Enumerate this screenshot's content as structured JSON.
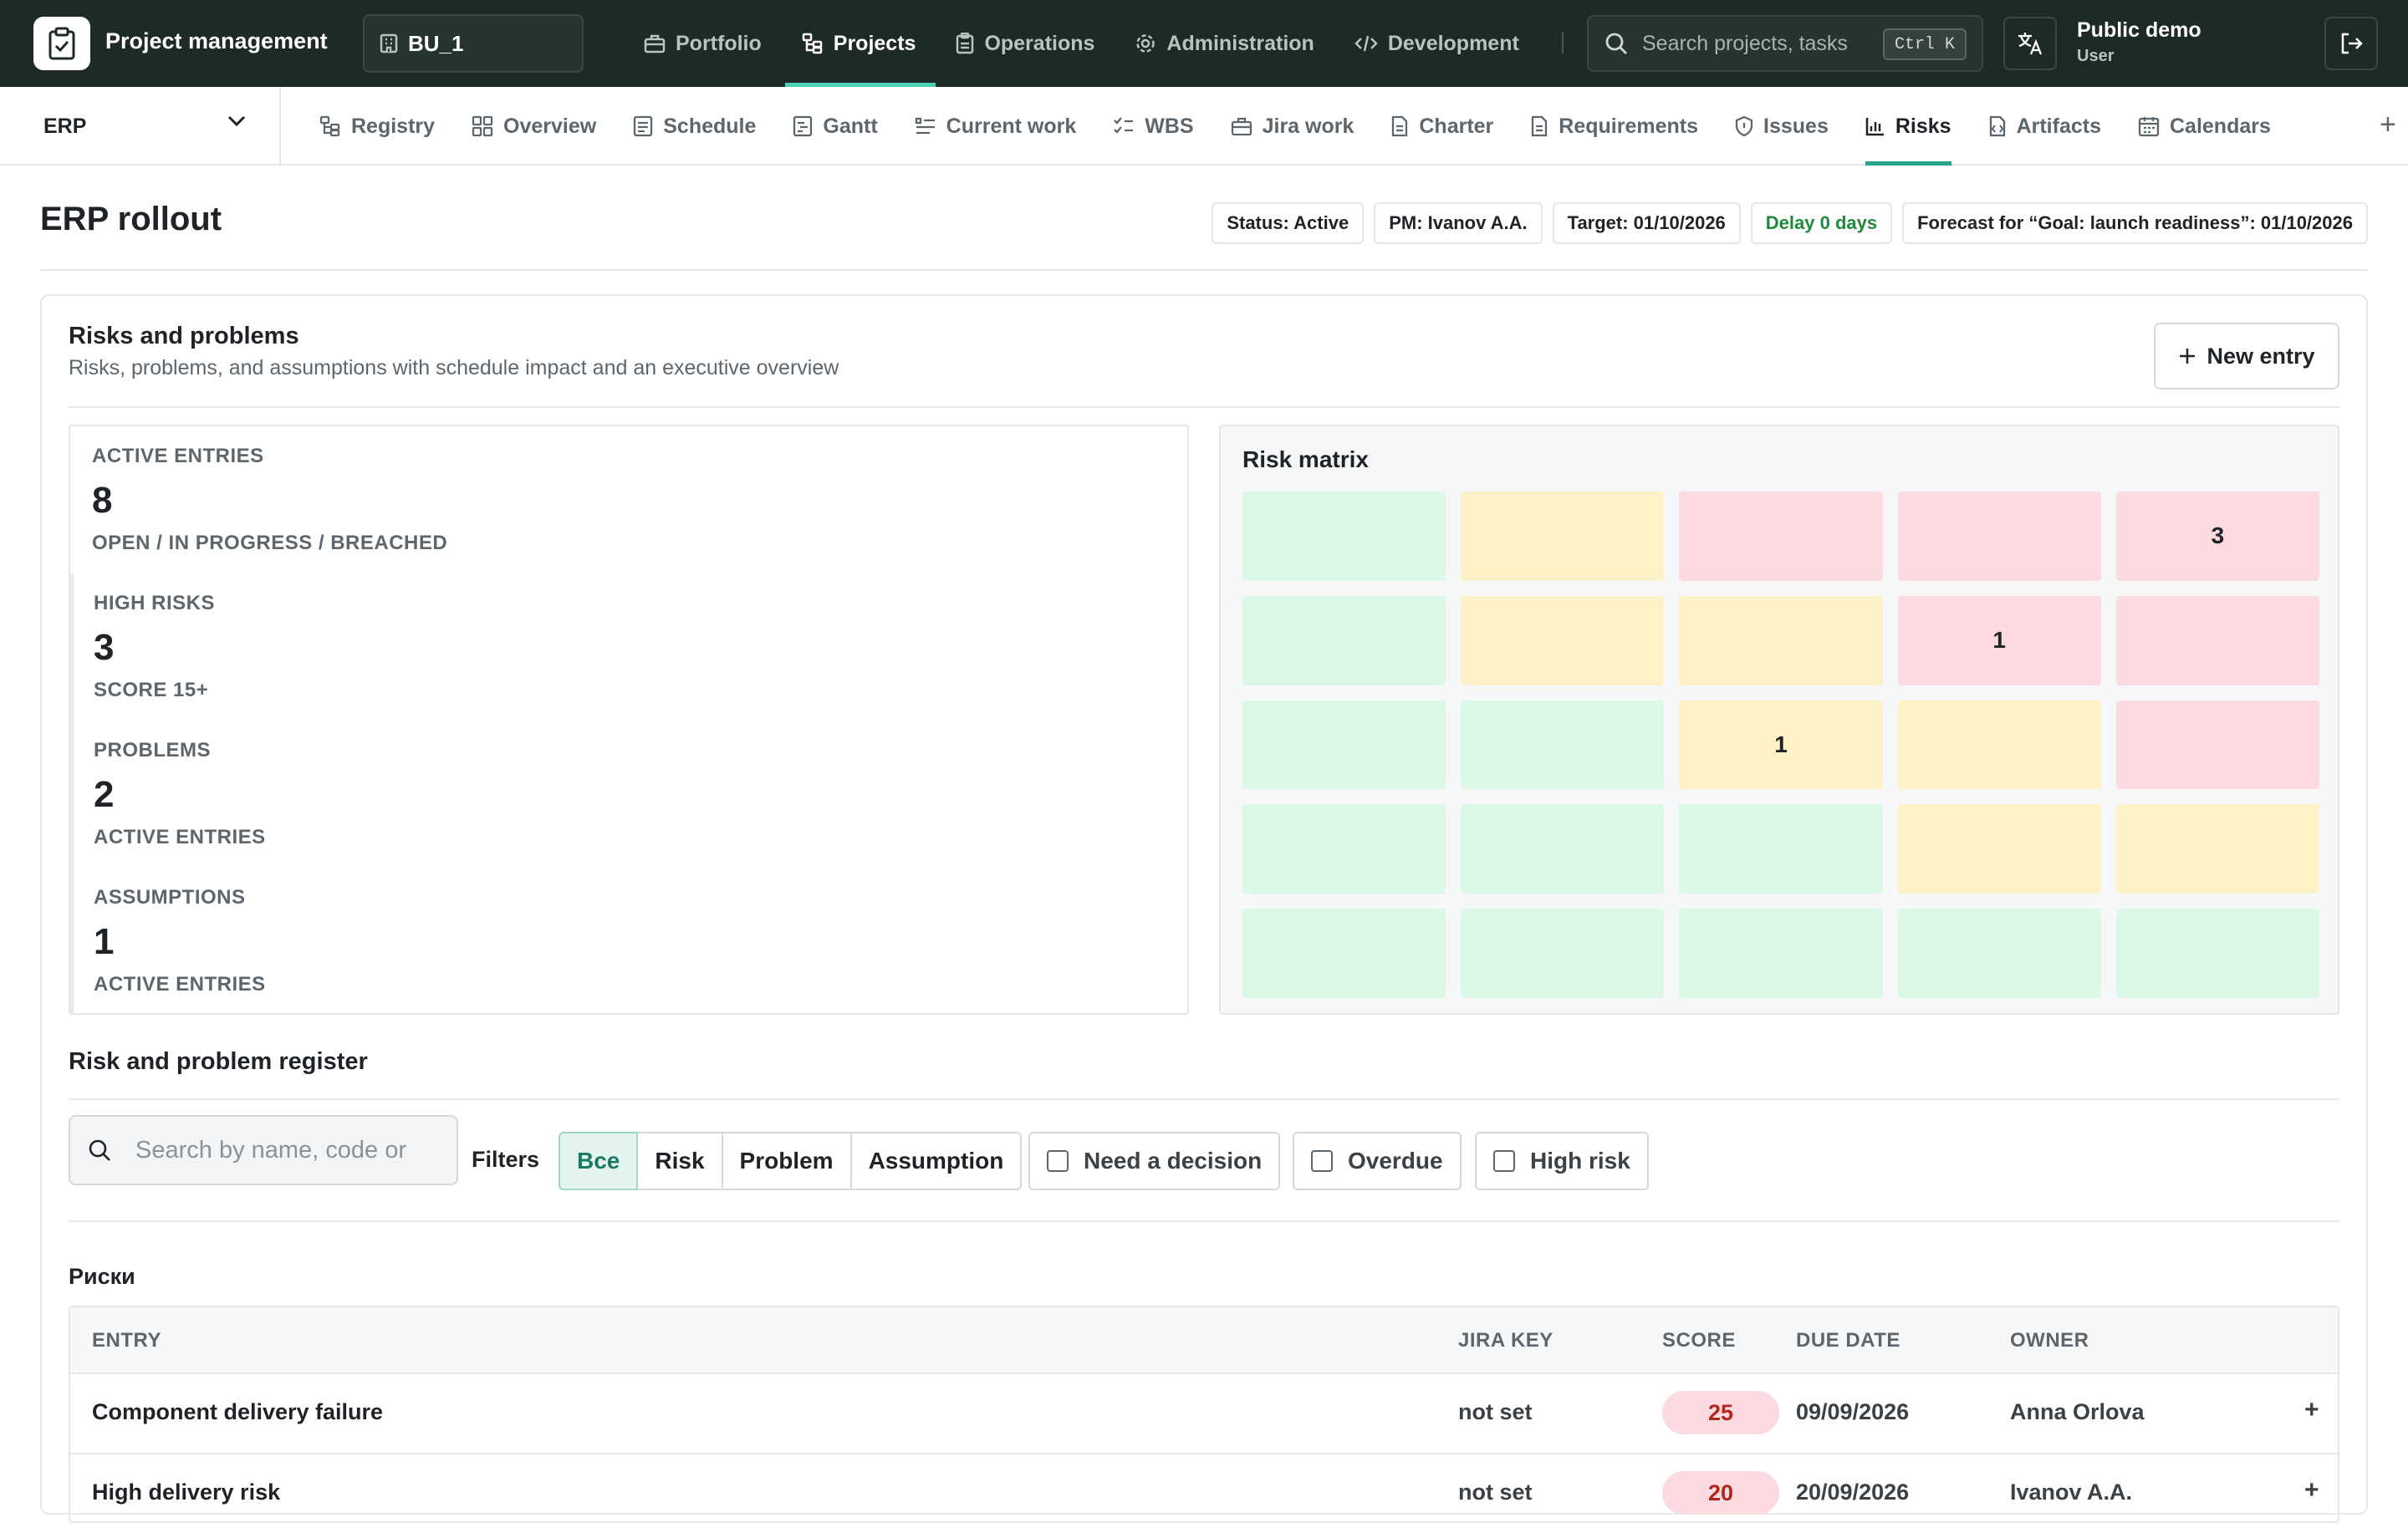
{
  "app": {
    "title": "Project management",
    "business_unit": "BU_1"
  },
  "top_nav": [
    {
      "label": "Portfolio",
      "icon": "briefcase-icon",
      "active": false
    },
    {
      "label": "Projects",
      "icon": "projects-icon",
      "active": true
    },
    {
      "label": "Operations",
      "icon": "clipboard-icon",
      "active": false
    },
    {
      "label": "Administration",
      "icon": "gear-icon",
      "active": false
    },
    {
      "label": "Development",
      "icon": "code-icon",
      "active": false
    }
  ],
  "search": {
    "placeholder": "Search projects, tasks",
    "shortcut": "Ctrl K"
  },
  "user": {
    "name": "Public demo",
    "role": "User"
  },
  "project_selector": {
    "value": "ERP"
  },
  "sub_nav": [
    {
      "label": "Registry",
      "icon": "registry-icon",
      "active": false
    },
    {
      "label": "Overview",
      "icon": "grid-icon",
      "active": false
    },
    {
      "label": "Schedule",
      "icon": "schedule-icon",
      "active": false
    },
    {
      "label": "Gantt",
      "icon": "gantt-icon",
      "active": false
    },
    {
      "label": "Current work",
      "icon": "list-icon",
      "active": false
    },
    {
      "label": "WBS",
      "icon": "checklist-icon",
      "active": false
    },
    {
      "label": "Jira work",
      "icon": "briefcase-icon",
      "active": false
    },
    {
      "label": "Charter",
      "icon": "document-icon",
      "active": false
    },
    {
      "label": "Requirements",
      "icon": "document-icon",
      "active": false
    },
    {
      "label": "Issues",
      "icon": "shield-icon",
      "active": false
    },
    {
      "label": "Risks",
      "icon": "bar-chart-icon",
      "active": true
    },
    {
      "label": "Artifacts",
      "icon": "file-icon",
      "active": false
    },
    {
      "label": "Calendars",
      "icon": "calendar-icon",
      "active": false
    }
  ],
  "page": {
    "title": "ERP rollout",
    "chips": {
      "status": "Status: Active",
      "pm": "PM: Ivanov A.A.",
      "target": "Target: 01/10/2026",
      "delay": "Delay 0 days",
      "forecast": "Forecast for “Goal: launch readiness”: 01/10/2026"
    }
  },
  "risks_card": {
    "title": "Risks and problems",
    "subtitle": "Risks, problems, and assumptions with schedule impact and an executive overview",
    "new_entry_label": "New entry"
  },
  "stats": [
    {
      "label": "ACTIVE ENTRIES",
      "value": "8",
      "note": "OPEN / IN PROGRESS / BREACHED"
    },
    {
      "label": "HIGH RISKS",
      "value": "3",
      "note": "SCORE 15+"
    },
    {
      "label": "PROBLEMS",
      "value": "2",
      "note": "ACTIVE ENTRIES"
    },
    {
      "label": "ASSUMPTIONS",
      "value": "1",
      "note": "ACTIVE ENTRIES"
    }
  ],
  "risk_matrix": {
    "title": "Risk matrix",
    "rows": [
      [
        {
          "level": "low",
          "count": ""
        },
        {
          "level": "medium",
          "count": ""
        },
        {
          "level": "high",
          "count": ""
        },
        {
          "level": "high",
          "count": ""
        },
        {
          "level": "high",
          "count": "3"
        }
      ],
      [
        {
          "level": "low",
          "count": ""
        },
        {
          "level": "medium",
          "count": ""
        },
        {
          "level": "medium",
          "count": ""
        },
        {
          "level": "high",
          "count": "1"
        },
        {
          "level": "high",
          "count": ""
        }
      ],
      [
        {
          "level": "low",
          "count": ""
        },
        {
          "level": "low",
          "count": ""
        },
        {
          "level": "medium",
          "count": "1"
        },
        {
          "level": "medium",
          "count": ""
        },
        {
          "level": "high",
          "count": ""
        }
      ],
      [
        {
          "level": "low",
          "count": ""
        },
        {
          "level": "low",
          "count": ""
        },
        {
          "level": "low",
          "count": ""
        },
        {
          "level": "medium",
          "count": ""
        },
        {
          "level": "medium",
          "count": ""
        }
      ],
      [
        {
          "level": "low",
          "count": ""
        },
        {
          "level": "low",
          "count": ""
        },
        {
          "level": "low",
          "count": ""
        },
        {
          "level": "low",
          "count": ""
        },
        {
          "level": "low",
          "count": ""
        }
      ]
    ],
    "colors": {
      "low": "#dcf8e6",
      "medium": "#fdf1c7",
      "high": "#fbdbe0"
    }
  },
  "register": {
    "title": "Risk and problem register",
    "search_placeholder": "Search by name, code or",
    "filters_label": "Filters",
    "type_filters": [
      {
        "label": "Все",
        "active": true
      },
      {
        "label": "Risk",
        "active": false
      },
      {
        "label": "Problem",
        "active": false
      },
      {
        "label": "Assumption",
        "active": false
      }
    ],
    "checks": [
      {
        "label": "Need a decision",
        "checked": false
      },
      {
        "label": "Overdue",
        "checked": false
      },
      {
        "label": "High risk",
        "checked": false
      }
    ],
    "group_title": "Риски",
    "columns": [
      "ENTRY",
      "JIRA KEY",
      "SCORE",
      "DUE DATE",
      "OWNER"
    ],
    "rows": [
      {
        "entry": "Component delivery failure",
        "jira_key": "not set",
        "score": "25",
        "due_date": "09/09/2026",
        "owner": "Anna Orlova",
        "action": "+"
      },
      {
        "entry": "High delivery risk",
        "jira_key": "not set",
        "score": "20",
        "due_date": "20/09/2026",
        "owner": "Ivanov A.A.",
        "action": "+"
      }
    ]
  },
  "colors": {
    "topbar": "#1d2a27",
    "accent": "#2aa38c",
    "delay_green": "#1f8a3b",
    "score_badge_bg": "#fbdbe0",
    "score_badge_fg": "#b3261e"
  }
}
